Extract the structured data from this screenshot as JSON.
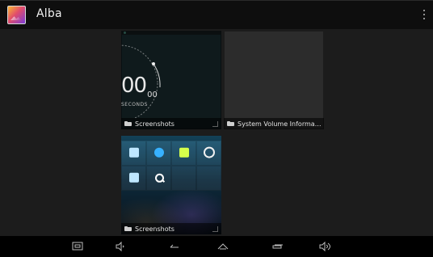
{
  "app": {
    "title": "Alba",
    "icon": "gallery-app-icon"
  },
  "action_bar": {
    "overflow_icon": "overflow-menu-icon"
  },
  "albums": [
    {
      "name": "Screenshots",
      "preview": {
        "clock_text": "00",
        "clock_small": "00",
        "subtitle": "SECONDS"
      }
    },
    {
      "name": "System Volume Informat..."
    },
    {
      "name": "Screenshots"
    }
  ],
  "navigation": {
    "buttons": [
      "screenshot-icon",
      "volume-down-icon",
      "back-icon",
      "home-icon",
      "recents-icon",
      "volume-up-icon"
    ]
  },
  "colors": {
    "background": "#1c1c1c",
    "bar": "#0e0e0e",
    "nav": "#000000"
  }
}
